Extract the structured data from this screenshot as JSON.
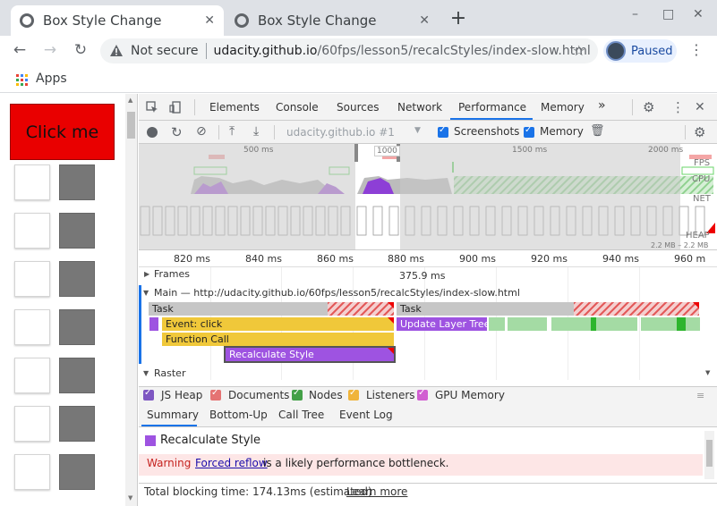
{
  "tabs": [
    {
      "title": "Box Style Change",
      "active": true
    },
    {
      "title": "Box Style Change",
      "active": false
    }
  ],
  "window_controls": {
    "minimize": "–",
    "maximize": "□",
    "close": "✕"
  },
  "toolbar": {
    "not_secure": "Not secure",
    "url_host": "udacity.github.io",
    "url_path": "/60fps/lesson5/recalcStyles/index-slow.html",
    "profile_label": "Paused"
  },
  "bookmarks": {
    "apps_label": "Apps"
  },
  "page": {
    "button_label": "Click me",
    "box_rows": 7
  },
  "devtools": {
    "tabs": [
      "Elements",
      "Console",
      "Sources",
      "Network",
      "Performance",
      "Memory",
      "»"
    ],
    "active_tab": "Performance",
    "recording_select": "udacity.github.io #1",
    "screenshots_label": "Screenshots",
    "memory_label": "Memory",
    "overview": {
      "ruler": [
        "500 ms",
        "1000",
        "1500 ms",
        "2000 ms"
      ],
      "labels": [
        "FPS",
        "CPU",
        "NET",
        "HEAP"
      ],
      "heap_range": "2.2 MB – 2.2 MB"
    },
    "timeline_ticks": [
      "820 ms",
      "840 ms",
      "860 ms",
      "880 ms",
      "900 ms",
      "920 ms",
      "940 ms",
      "960 m"
    ],
    "frames_label": "Frames",
    "frames_duration": "375.9 ms",
    "main_label": "Main — http://udacity.github.io/60fps/lesson5/recalcStyles/index-slow.html",
    "raster_label": "Raster",
    "flame": {
      "task1": "Task",
      "task2": "Task",
      "event_click": "Event: click",
      "update_layer_tree": "Update Layer Tree",
      "function_call": "Function Call",
      "recalc_style": "Recalculate Style"
    },
    "legend": [
      "JS Heap",
      "Documents",
      "Nodes",
      "Listeners",
      "GPU Memory"
    ],
    "legend_colors": [
      "#7e57c2",
      "#e57373",
      "#43a047",
      "#f0b43a",
      "#d15fd1"
    ],
    "subtabs": [
      "Summary",
      "Bottom-Up",
      "Call Tree",
      "Event Log"
    ],
    "summary": {
      "title": "Recalculate Style",
      "warning_label": "Warning",
      "warning_link": "Forced reflow",
      "warning_text": "is a likely performance bottleneck."
    },
    "total_blocking": "Total blocking time: 174.13ms (estimated)",
    "learn_more": "Learn more"
  }
}
